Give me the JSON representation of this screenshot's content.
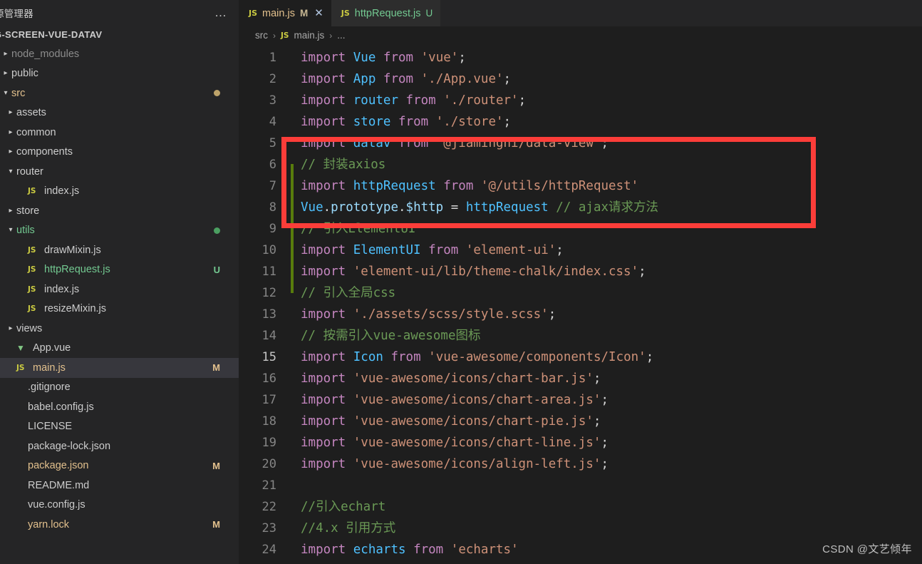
{
  "sidebar": {
    "header_title": "源管理器",
    "overflow_icon": "ellipsis-icon",
    "project_name": "G-SCREEN-VUE-DATAV",
    "items": [
      {
        "label": "node_modules",
        "indent": 0,
        "kind": "folder",
        "twisty": "closed",
        "style": "dim",
        "badge": "",
        "dot": ""
      },
      {
        "label": "public",
        "indent": 0,
        "kind": "folder",
        "twisty": "closed",
        "style": "normal",
        "badge": "",
        "dot": ""
      },
      {
        "label": "src",
        "indent": 0,
        "kind": "folder",
        "twisty": "open",
        "style": "mod",
        "badge": "",
        "dot": "mod"
      },
      {
        "label": "assets",
        "indent": 1,
        "kind": "folder",
        "twisty": "closed",
        "style": "normal",
        "badge": "",
        "dot": ""
      },
      {
        "label": "common",
        "indent": 1,
        "kind": "folder",
        "twisty": "closed",
        "style": "normal",
        "badge": "",
        "dot": ""
      },
      {
        "label": "components",
        "indent": 1,
        "kind": "folder",
        "twisty": "closed",
        "style": "normal",
        "badge": "",
        "dot": ""
      },
      {
        "label": "router",
        "indent": 1,
        "kind": "folder",
        "twisty": "open",
        "style": "normal",
        "badge": "",
        "dot": ""
      },
      {
        "label": "index.js",
        "indent": 2,
        "kind": "js",
        "twisty": "none",
        "style": "normal",
        "badge": "",
        "dot": ""
      },
      {
        "label": "store",
        "indent": 1,
        "kind": "folder",
        "twisty": "closed",
        "style": "normal",
        "badge": "",
        "dot": ""
      },
      {
        "label": "utils",
        "indent": 1,
        "kind": "folder",
        "twisty": "open",
        "style": "green",
        "badge": "",
        "dot": "unt"
      },
      {
        "label": "drawMixin.js",
        "indent": 2,
        "kind": "js",
        "twisty": "none",
        "style": "normal",
        "badge": "",
        "dot": ""
      },
      {
        "label": "httpRequest.js",
        "indent": 2,
        "kind": "js",
        "twisty": "none",
        "style": "green",
        "badge": "U",
        "badge_kind": "u",
        "dot": ""
      },
      {
        "label": "index.js",
        "indent": 2,
        "kind": "js",
        "twisty": "none",
        "style": "normal",
        "badge": "",
        "dot": ""
      },
      {
        "label": "resizeMixin.js",
        "indent": 2,
        "kind": "js",
        "twisty": "none",
        "style": "normal",
        "badge": "",
        "dot": ""
      },
      {
        "label": "views",
        "indent": 1,
        "kind": "folder",
        "twisty": "closed",
        "style": "normal",
        "badge": "",
        "dot": ""
      },
      {
        "label": "App.vue",
        "indent": 1,
        "kind": "vue",
        "twisty": "none",
        "style": "normal",
        "badge": "",
        "dot": ""
      },
      {
        "label": "main.js",
        "indent": 1,
        "kind": "js",
        "twisty": "none",
        "style": "mod",
        "badge": "M",
        "badge_kind": "m",
        "dot": "",
        "selected": true
      },
      {
        "label": ".gitignore",
        "indent": 0,
        "kind": "file",
        "twisty": "none",
        "style": "normal",
        "badge": "",
        "dot": ""
      },
      {
        "label": "babel.config.js",
        "indent": 0,
        "kind": "file",
        "twisty": "none",
        "style": "normal",
        "badge": "",
        "dot": ""
      },
      {
        "label": "LICENSE",
        "indent": 0,
        "kind": "file",
        "twisty": "none",
        "style": "normal",
        "badge": "",
        "dot": ""
      },
      {
        "label": "package-lock.json",
        "indent": 0,
        "kind": "file",
        "twisty": "none",
        "style": "normal",
        "badge": "",
        "dot": ""
      },
      {
        "label": "package.json",
        "indent": 0,
        "kind": "file",
        "twisty": "none",
        "style": "mod",
        "badge": "M",
        "badge_kind": "m",
        "dot": ""
      },
      {
        "label": "README.md",
        "indent": 0,
        "kind": "file",
        "twisty": "none",
        "style": "normal",
        "badge": "",
        "dot": ""
      },
      {
        "label": "vue.config.js",
        "indent": 0,
        "kind": "file",
        "twisty": "none",
        "style": "normal",
        "badge": "",
        "dot": ""
      },
      {
        "label": "yarn.lock",
        "indent": 0,
        "kind": "file",
        "twisty": "none",
        "style": "mod",
        "badge": "M",
        "badge_kind": "m",
        "dot": ""
      }
    ]
  },
  "tabs": [
    {
      "icon": "JS",
      "name": "main.js",
      "status": "M",
      "active": true,
      "close": "✕"
    },
    {
      "icon": "JS",
      "name": "httpRequest.js",
      "status": "U",
      "active": false,
      "close": ""
    }
  ],
  "breadcrumb": {
    "root": "src",
    "sep": "›",
    "icon": "JS",
    "file": "main.js",
    "tail": "..."
  },
  "editor": {
    "current_line": 15,
    "lines": [
      {
        "n": 1,
        "changed": false,
        "tokens": [
          {
            "t": "import",
            "c": "kw"
          },
          {
            "t": " ",
            "c": "pun"
          },
          {
            "t": "Vue",
            "c": "id"
          },
          {
            "t": " ",
            "c": "pun"
          },
          {
            "t": "from",
            "c": "kw"
          },
          {
            "t": " ",
            "c": "pun"
          },
          {
            "t": "'vue'",
            "c": "str"
          },
          {
            "t": ";",
            "c": "pun"
          }
        ]
      },
      {
        "n": 2,
        "changed": false,
        "tokens": [
          {
            "t": "import",
            "c": "kw"
          },
          {
            "t": " ",
            "c": "pun"
          },
          {
            "t": "App",
            "c": "id"
          },
          {
            "t": " ",
            "c": "pun"
          },
          {
            "t": "from",
            "c": "kw"
          },
          {
            "t": " ",
            "c": "pun"
          },
          {
            "t": "'./App.vue'",
            "c": "str"
          },
          {
            "t": ";",
            "c": "pun"
          }
        ]
      },
      {
        "n": 3,
        "changed": false,
        "tokens": [
          {
            "t": "import",
            "c": "kw"
          },
          {
            "t": " ",
            "c": "pun"
          },
          {
            "t": "router",
            "c": "id"
          },
          {
            "t": " ",
            "c": "pun"
          },
          {
            "t": "from",
            "c": "kw"
          },
          {
            "t": " ",
            "c": "pun"
          },
          {
            "t": "'./router'",
            "c": "str"
          },
          {
            "t": ";",
            "c": "pun"
          }
        ]
      },
      {
        "n": 4,
        "changed": false,
        "tokens": [
          {
            "t": "import",
            "c": "kw"
          },
          {
            "t": " ",
            "c": "pun"
          },
          {
            "t": "store",
            "c": "id"
          },
          {
            "t": " ",
            "c": "pun"
          },
          {
            "t": "from",
            "c": "kw"
          },
          {
            "t": " ",
            "c": "pun"
          },
          {
            "t": "'./store'",
            "c": "str"
          },
          {
            "t": ";",
            "c": "pun"
          }
        ]
      },
      {
        "n": 5,
        "changed": false,
        "tokens": [
          {
            "t": "import",
            "c": "kw"
          },
          {
            "t": " ",
            "c": "pun"
          },
          {
            "t": "datav",
            "c": "id"
          },
          {
            "t": " ",
            "c": "pun"
          },
          {
            "t": "from",
            "c": "kw"
          },
          {
            "t": " ",
            "c": "pun"
          },
          {
            "t": "'@jiaminghi/data-view'",
            "c": "str"
          },
          {
            "t": ";",
            "c": "pun"
          }
        ]
      },
      {
        "n": 6,
        "changed": true,
        "tokens": [
          {
            "t": "// 封装axios",
            "c": "com"
          }
        ]
      },
      {
        "n": 7,
        "changed": true,
        "tokens": [
          {
            "t": "import",
            "c": "kw"
          },
          {
            "t": " ",
            "c": "pun"
          },
          {
            "t": "httpRequest",
            "c": "id"
          },
          {
            "t": " ",
            "c": "pun"
          },
          {
            "t": "from",
            "c": "kw"
          },
          {
            "t": " ",
            "c": "pun"
          },
          {
            "t": "'@/utils/httpRequest'",
            "c": "str"
          }
        ]
      },
      {
        "n": 8,
        "changed": true,
        "tokens": [
          {
            "t": "Vue",
            "c": "id"
          },
          {
            "t": ".",
            "c": "pun"
          },
          {
            "t": "prototype",
            "c": "var"
          },
          {
            "t": ".",
            "c": "pun"
          },
          {
            "t": "$http",
            "c": "var"
          },
          {
            "t": " = ",
            "c": "op"
          },
          {
            "t": "httpRequest",
            "c": "id"
          },
          {
            "t": " ",
            "c": "pun"
          },
          {
            "t": "// ajax请求方法",
            "c": "com"
          }
        ]
      },
      {
        "n": 9,
        "changed": true,
        "tokens": [
          {
            "t": "// 引入ElementUI",
            "c": "com"
          }
        ]
      },
      {
        "n": 10,
        "changed": true,
        "tokens": [
          {
            "t": "import",
            "c": "kw"
          },
          {
            "t": " ",
            "c": "pun"
          },
          {
            "t": "ElementUI",
            "c": "id"
          },
          {
            "t": " ",
            "c": "pun"
          },
          {
            "t": "from",
            "c": "kw"
          },
          {
            "t": " ",
            "c": "pun"
          },
          {
            "t": "'element-ui'",
            "c": "str"
          },
          {
            "t": ";",
            "c": "pun"
          }
        ]
      },
      {
        "n": 11,
        "changed": true,
        "tokens": [
          {
            "t": "import",
            "c": "kw"
          },
          {
            "t": " ",
            "c": "pun"
          },
          {
            "t": "'element-ui/lib/theme-chalk/index.css'",
            "c": "str"
          },
          {
            "t": ";",
            "c": "pun"
          }
        ]
      },
      {
        "n": 12,
        "changed": false,
        "tokens": [
          {
            "t": "// 引入全局css",
            "c": "com"
          }
        ]
      },
      {
        "n": 13,
        "changed": false,
        "tokens": [
          {
            "t": "import",
            "c": "kw"
          },
          {
            "t": " ",
            "c": "pun"
          },
          {
            "t": "'./assets/scss/style.scss'",
            "c": "str"
          },
          {
            "t": ";",
            "c": "pun"
          }
        ]
      },
      {
        "n": 14,
        "changed": false,
        "tokens": [
          {
            "t": "// 按需引入vue-awesome图标",
            "c": "com"
          }
        ]
      },
      {
        "n": 15,
        "changed": false,
        "tokens": [
          {
            "t": "import",
            "c": "kw"
          },
          {
            "t": " ",
            "c": "pun"
          },
          {
            "t": "Icon",
            "c": "id"
          },
          {
            "t": " ",
            "c": "pun"
          },
          {
            "t": "from",
            "c": "kw"
          },
          {
            "t": " ",
            "c": "pun"
          },
          {
            "t": "'vue-awesome/components/Icon'",
            "c": "str"
          },
          {
            "t": ";",
            "c": "pun"
          }
        ]
      },
      {
        "n": 16,
        "changed": false,
        "tokens": [
          {
            "t": "import",
            "c": "kw"
          },
          {
            "t": " ",
            "c": "pun"
          },
          {
            "t": "'vue-awesome/icons/chart-bar.js'",
            "c": "str"
          },
          {
            "t": ";",
            "c": "pun"
          }
        ]
      },
      {
        "n": 17,
        "changed": false,
        "tokens": [
          {
            "t": "import",
            "c": "kw"
          },
          {
            "t": " ",
            "c": "pun"
          },
          {
            "t": "'vue-awesome/icons/chart-area.js'",
            "c": "str"
          },
          {
            "t": ";",
            "c": "pun"
          }
        ]
      },
      {
        "n": 18,
        "changed": false,
        "tokens": [
          {
            "t": "import",
            "c": "kw"
          },
          {
            "t": " ",
            "c": "pun"
          },
          {
            "t": "'vue-awesome/icons/chart-pie.js'",
            "c": "str"
          },
          {
            "t": ";",
            "c": "pun"
          }
        ]
      },
      {
        "n": 19,
        "changed": false,
        "tokens": [
          {
            "t": "import",
            "c": "kw"
          },
          {
            "t": " ",
            "c": "pun"
          },
          {
            "t": "'vue-awesome/icons/chart-line.js'",
            "c": "str"
          },
          {
            "t": ";",
            "c": "pun"
          }
        ]
      },
      {
        "n": 20,
        "changed": false,
        "tokens": [
          {
            "t": "import",
            "c": "kw"
          },
          {
            "t": " ",
            "c": "pun"
          },
          {
            "t": "'vue-awesome/icons/align-left.js'",
            "c": "str"
          },
          {
            "t": ";",
            "c": "pun"
          }
        ]
      },
      {
        "n": 21,
        "changed": false,
        "tokens": []
      },
      {
        "n": 22,
        "changed": false,
        "tokens": [
          {
            "t": "//引入echart",
            "c": "com"
          }
        ]
      },
      {
        "n": 23,
        "changed": false,
        "tokens": [
          {
            "t": "//4.x 引用方式",
            "c": "com"
          }
        ]
      },
      {
        "n": 24,
        "changed": false,
        "tokens": [
          {
            "t": "import",
            "c": "kw"
          },
          {
            "t": " ",
            "c": "pun"
          },
          {
            "t": "echarts",
            "c": "id"
          },
          {
            "t": " ",
            "c": "pun"
          },
          {
            "t": "from",
            "c": "kw"
          },
          {
            "t": " ",
            "c": "pun"
          },
          {
            "t": "'echarts'",
            "c": "str"
          }
        ]
      }
    ]
  },
  "annotation": {
    "kind": "red-rectangle-highlight",
    "color": "#fc3d39"
  },
  "watermark": "CSDN @文艺倾年",
  "colors": {
    "editor_bg": "#1e1e1e",
    "sidebar_bg": "#252526",
    "tab_inactive_bg": "#2d2d2d",
    "selected_row_bg": "#37373d",
    "keyword": "#c586c0",
    "identifier": "#4fc1ff",
    "string": "#ce9178",
    "comment": "#6a9955",
    "modified": "#e2c08d",
    "untracked": "#73c991",
    "gutter_changed": "#587c0c",
    "annotation_red": "#fc3d39"
  }
}
